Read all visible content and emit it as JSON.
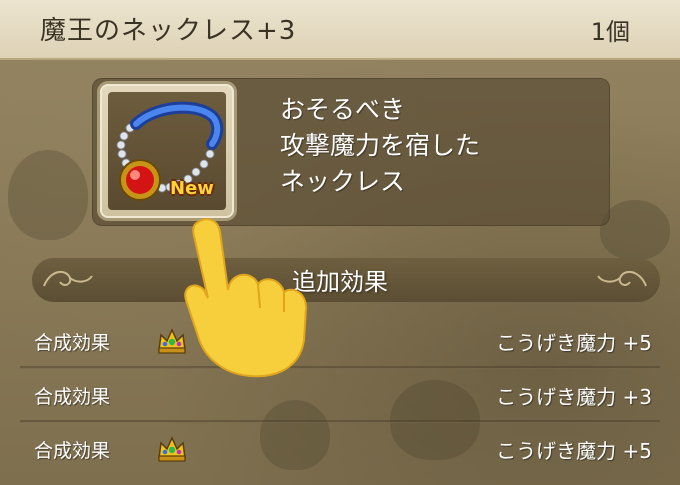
{
  "header": {
    "item_name": "魔王のネックレス+3",
    "count": "1個"
  },
  "item": {
    "icon": "necklace-icon",
    "badge": "New",
    "description": [
      "おそるべき",
      "攻撃魔力を宿した",
      "ネックレス"
    ]
  },
  "section": {
    "title": "追加効果"
  },
  "effects": [
    {
      "label": "合成効果",
      "has_crown": true,
      "value": "こうげき魔力 +5"
    },
    {
      "label": "合成効果",
      "has_crown": false,
      "value": "こうげき魔力 +3"
    },
    {
      "label": "合成効果",
      "has_crown": true,
      "value": "こうげき魔力 +5"
    }
  ],
  "colors": {
    "header_bg": "#e6dcc4",
    "panel_bg": "#8b7b58",
    "badge": "#ffd23a",
    "gem": "#d81818",
    "strap": "#2a5fd0"
  }
}
